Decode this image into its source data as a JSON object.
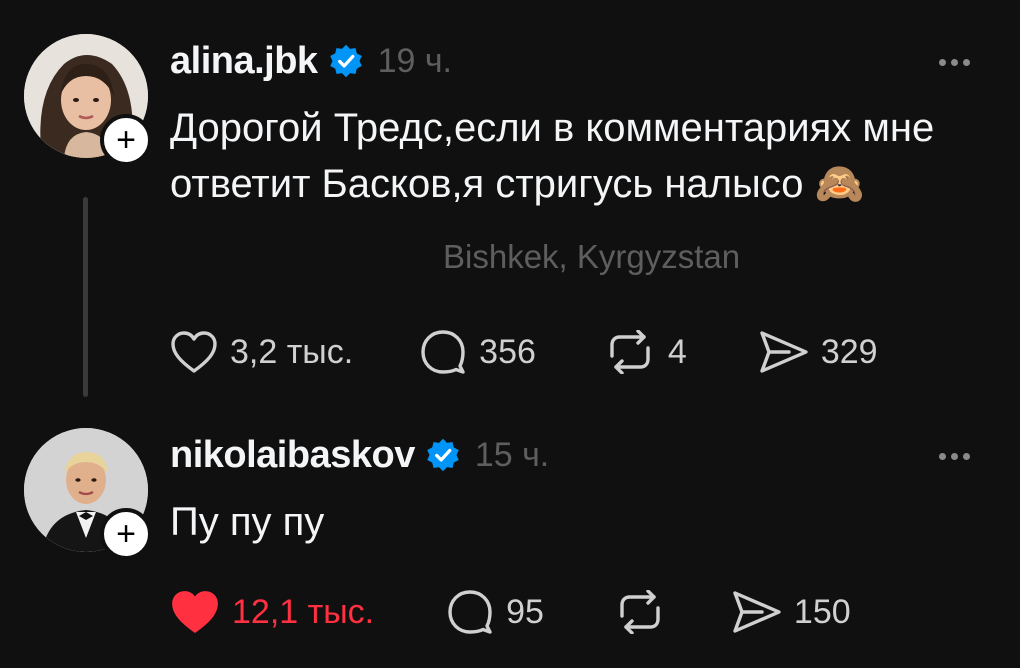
{
  "posts": [
    {
      "username": "alina.jbk",
      "time": "19 ч.",
      "text_line1": "Дорогой Тредс,если в комментариях мне",
      "text_line2": "ответит Басков,я стригусь налысо 🙈",
      "location": "Bishkek, Kyrgyzstan",
      "likes": "3,2 тыс.",
      "comments": "356",
      "reposts": "4",
      "shares": "329",
      "liked": false
    },
    {
      "username": "nikolaibaskov",
      "time": "15 ч.",
      "text_line1": "Пу пу пу",
      "likes": "12,1 тыс.",
      "comments": "95",
      "shares": "150",
      "liked": true
    }
  ],
  "icons": {
    "verified": "verified-badge-icon",
    "follow": "plus-icon",
    "more": "more-dots-icon",
    "like": "heart-icon",
    "comment": "comment-bubble-icon",
    "repost": "repost-icon",
    "share": "send-icon"
  },
  "colors": {
    "background": "#101010",
    "verified": "#0095f6",
    "liked": "#ff3040",
    "muted": "#5e5e5e"
  }
}
